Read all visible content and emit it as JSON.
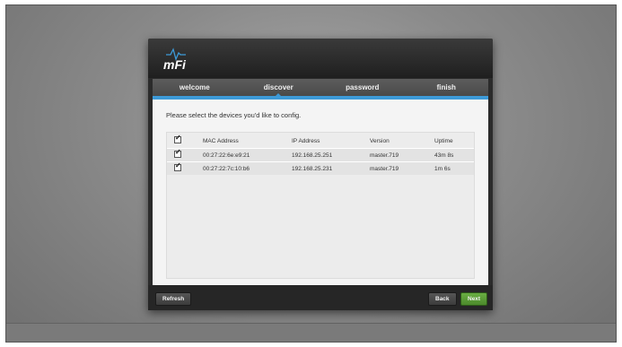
{
  "app": {
    "logo_text": "mFi"
  },
  "tabs": [
    {
      "label": "welcome"
    },
    {
      "label": "discover"
    },
    {
      "label": "password"
    },
    {
      "label": "finish"
    }
  ],
  "content": {
    "prompt": "Please select the devices you'd like to config.",
    "columns": {
      "mac": "MAC Address",
      "ip": "IP Address",
      "version": "Version",
      "uptime": "Uptime"
    },
    "rows": [
      {
        "mac": "00:27:22:6e:e9:21",
        "ip": "192.168.25.251",
        "version": "master.719",
        "uptime": "43m 8s"
      },
      {
        "mac": "00:27:22:7c:10:b6",
        "ip": "192.168.25.231",
        "version": "master.719",
        "uptime": "1m 6s"
      }
    ]
  },
  "footer": {
    "refresh_label": "Refresh",
    "back_label": "Back",
    "next_label": "Next"
  },
  "colors": {
    "accent": "#3d9ad8",
    "next_button": "#5a9c38"
  }
}
